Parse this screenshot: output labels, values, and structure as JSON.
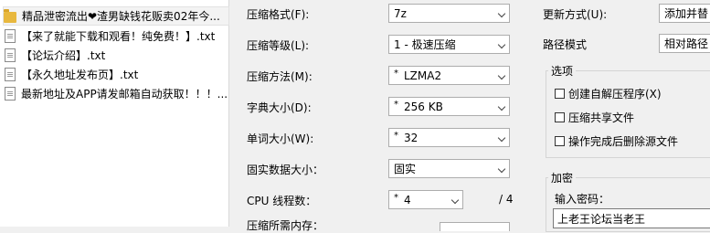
{
  "files": [
    {
      "icon": "folder",
      "name": "精品泄密流出❤渣男缺钱花贩卖02年今..."
    },
    {
      "icon": "txt",
      "name": "【来了就能下载和观看！纯免费！】.txt"
    },
    {
      "icon": "txt",
      "name": "【论坛介绍】.txt"
    },
    {
      "icon": "txt",
      "name": "【永久地址发布页】.txt"
    },
    {
      "icon": "txt",
      "name": "最新地址及APP请发邮箱自动获取！！！..."
    }
  ],
  "settings": {
    "format_label": "压缩格式(F):",
    "format_value": "7z",
    "level_label": "压缩等级(L):",
    "level_value": "1 - 极速压缩",
    "method_label": "压缩方法(M):",
    "method_value": "LZMA2",
    "dict_label": "字典大小(D):",
    "dict_value": "256 KB",
    "word_label": "单词大小(W):",
    "word_value": "32",
    "solid_label": "固实数据大小：",
    "solid_value": "固实",
    "cpu_label": "CPU 线程数：",
    "cpu_value": "4",
    "cpu_total": "/ 4",
    "memory_label": "压缩所需内存："
  },
  "right": {
    "update_label": "更新方式(U):",
    "update_value": "添加并替",
    "path_label": "路径模式",
    "path_value": "相对路径",
    "options_title": "选项",
    "opt_sfx": "创建自解压程序(X)",
    "opt_shared": "压缩共享文件",
    "opt_delete": "操作完成后删除源文件",
    "encrypt_title": "加密",
    "password_label": "输入密码：",
    "password_value": "上老王论坛当老王"
  }
}
